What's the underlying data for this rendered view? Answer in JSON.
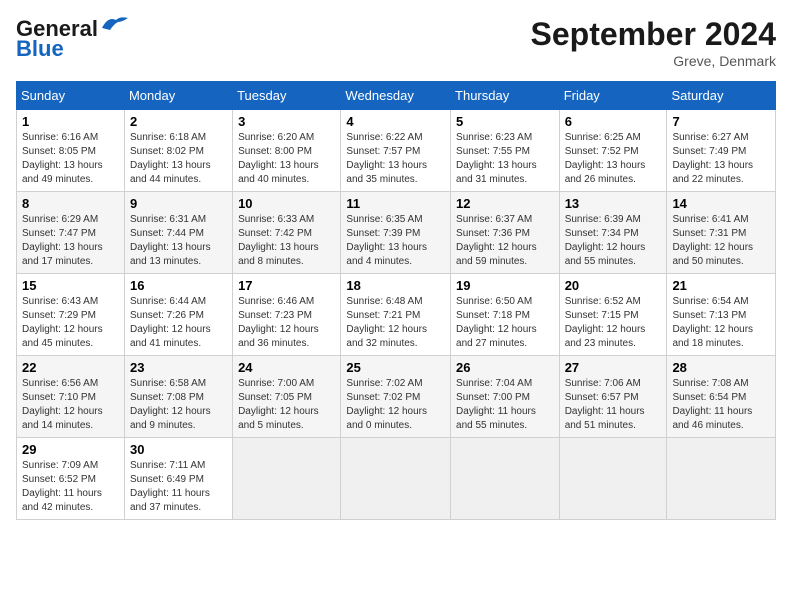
{
  "header": {
    "logo_general": "General",
    "logo_blue": "Blue",
    "month_year": "September 2024",
    "location": "Greve, Denmark"
  },
  "weekdays": [
    "Sunday",
    "Monday",
    "Tuesday",
    "Wednesday",
    "Thursday",
    "Friday",
    "Saturday"
  ],
  "weeks": [
    [
      {
        "num": "1",
        "sunrise": "Sunrise: 6:16 AM",
        "sunset": "Sunset: 8:05 PM",
        "daylight": "Daylight: 13 hours and 49 minutes."
      },
      {
        "num": "2",
        "sunrise": "Sunrise: 6:18 AM",
        "sunset": "Sunset: 8:02 PM",
        "daylight": "Daylight: 13 hours and 44 minutes."
      },
      {
        "num": "3",
        "sunrise": "Sunrise: 6:20 AM",
        "sunset": "Sunset: 8:00 PM",
        "daylight": "Daylight: 13 hours and 40 minutes."
      },
      {
        "num": "4",
        "sunrise": "Sunrise: 6:22 AM",
        "sunset": "Sunset: 7:57 PM",
        "daylight": "Daylight: 13 hours and 35 minutes."
      },
      {
        "num": "5",
        "sunrise": "Sunrise: 6:23 AM",
        "sunset": "Sunset: 7:55 PM",
        "daylight": "Daylight: 13 hours and 31 minutes."
      },
      {
        "num": "6",
        "sunrise": "Sunrise: 6:25 AM",
        "sunset": "Sunset: 7:52 PM",
        "daylight": "Daylight: 13 hours and 26 minutes."
      },
      {
        "num": "7",
        "sunrise": "Sunrise: 6:27 AM",
        "sunset": "Sunset: 7:49 PM",
        "daylight": "Daylight: 13 hours and 22 minutes."
      }
    ],
    [
      {
        "num": "8",
        "sunrise": "Sunrise: 6:29 AM",
        "sunset": "Sunset: 7:47 PM",
        "daylight": "Daylight: 13 hours and 17 minutes."
      },
      {
        "num": "9",
        "sunrise": "Sunrise: 6:31 AM",
        "sunset": "Sunset: 7:44 PM",
        "daylight": "Daylight: 13 hours and 13 minutes."
      },
      {
        "num": "10",
        "sunrise": "Sunrise: 6:33 AM",
        "sunset": "Sunset: 7:42 PM",
        "daylight": "Daylight: 13 hours and 8 minutes."
      },
      {
        "num": "11",
        "sunrise": "Sunrise: 6:35 AM",
        "sunset": "Sunset: 7:39 PM",
        "daylight": "Daylight: 13 hours and 4 minutes."
      },
      {
        "num": "12",
        "sunrise": "Sunrise: 6:37 AM",
        "sunset": "Sunset: 7:36 PM",
        "daylight": "Daylight: 12 hours and 59 minutes."
      },
      {
        "num": "13",
        "sunrise": "Sunrise: 6:39 AM",
        "sunset": "Sunset: 7:34 PM",
        "daylight": "Daylight: 12 hours and 55 minutes."
      },
      {
        "num": "14",
        "sunrise": "Sunrise: 6:41 AM",
        "sunset": "Sunset: 7:31 PM",
        "daylight": "Daylight: 12 hours and 50 minutes."
      }
    ],
    [
      {
        "num": "15",
        "sunrise": "Sunrise: 6:43 AM",
        "sunset": "Sunset: 7:29 PM",
        "daylight": "Daylight: 12 hours and 45 minutes."
      },
      {
        "num": "16",
        "sunrise": "Sunrise: 6:44 AM",
        "sunset": "Sunset: 7:26 PM",
        "daylight": "Daylight: 12 hours and 41 minutes."
      },
      {
        "num": "17",
        "sunrise": "Sunrise: 6:46 AM",
        "sunset": "Sunset: 7:23 PM",
        "daylight": "Daylight: 12 hours and 36 minutes."
      },
      {
        "num": "18",
        "sunrise": "Sunrise: 6:48 AM",
        "sunset": "Sunset: 7:21 PM",
        "daylight": "Daylight: 12 hours and 32 minutes."
      },
      {
        "num": "19",
        "sunrise": "Sunrise: 6:50 AM",
        "sunset": "Sunset: 7:18 PM",
        "daylight": "Daylight: 12 hours and 27 minutes."
      },
      {
        "num": "20",
        "sunrise": "Sunrise: 6:52 AM",
        "sunset": "Sunset: 7:15 PM",
        "daylight": "Daylight: 12 hours and 23 minutes."
      },
      {
        "num": "21",
        "sunrise": "Sunrise: 6:54 AM",
        "sunset": "Sunset: 7:13 PM",
        "daylight": "Daylight: 12 hours and 18 minutes."
      }
    ],
    [
      {
        "num": "22",
        "sunrise": "Sunrise: 6:56 AM",
        "sunset": "Sunset: 7:10 PM",
        "daylight": "Daylight: 12 hours and 14 minutes."
      },
      {
        "num": "23",
        "sunrise": "Sunrise: 6:58 AM",
        "sunset": "Sunset: 7:08 PM",
        "daylight": "Daylight: 12 hours and 9 minutes."
      },
      {
        "num": "24",
        "sunrise": "Sunrise: 7:00 AM",
        "sunset": "Sunset: 7:05 PM",
        "daylight": "Daylight: 12 hours and 5 minutes."
      },
      {
        "num": "25",
        "sunrise": "Sunrise: 7:02 AM",
        "sunset": "Sunset: 7:02 PM",
        "daylight": "Daylight: 12 hours and 0 minutes."
      },
      {
        "num": "26",
        "sunrise": "Sunrise: 7:04 AM",
        "sunset": "Sunset: 7:00 PM",
        "daylight": "Daylight: 11 hours and 55 minutes."
      },
      {
        "num": "27",
        "sunrise": "Sunrise: 7:06 AM",
        "sunset": "Sunset: 6:57 PM",
        "daylight": "Daylight: 11 hours and 51 minutes."
      },
      {
        "num": "28",
        "sunrise": "Sunrise: 7:08 AM",
        "sunset": "Sunset: 6:54 PM",
        "daylight": "Daylight: 11 hours and 46 minutes."
      }
    ],
    [
      {
        "num": "29",
        "sunrise": "Sunrise: 7:09 AM",
        "sunset": "Sunset: 6:52 PM",
        "daylight": "Daylight: 11 hours and 42 minutes."
      },
      {
        "num": "30",
        "sunrise": "Sunrise: 7:11 AM",
        "sunset": "Sunset: 6:49 PM",
        "daylight": "Daylight: 11 hours and 37 minutes."
      },
      null,
      null,
      null,
      null,
      null
    ]
  ]
}
